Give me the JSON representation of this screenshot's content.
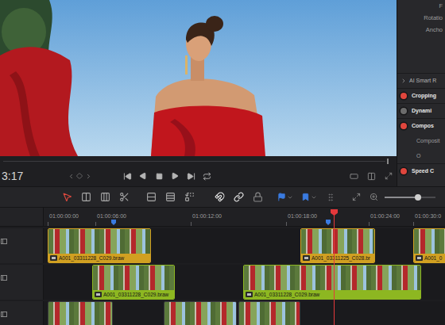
{
  "viewer": {
    "timecode": "3:17"
  },
  "inspector": {
    "params": [
      "F",
      "Rotatio",
      "Ancho"
    ],
    "sections": [
      {
        "label": "AI Smart R",
        "kind": "collapsed"
      },
      {
        "label": "Cropping",
        "kind": "toggle",
        "enabled": true
      },
      {
        "label": "Dynami",
        "kind": "toggle",
        "enabled": false
      },
      {
        "label": "Compos",
        "kind": "toggle",
        "enabled": true
      },
      {
        "label": "Composit",
        "kind": "param"
      },
      {
        "label": "O",
        "kind": "param"
      },
      {
        "label": "Speed C",
        "kind": "toggle",
        "enabled": true
      }
    ]
  },
  "toolbar": {
    "edit_tools": [
      {
        "selected": true
      },
      {
        "selected": false
      },
      {
        "selected": false
      },
      {
        "selected": false
      }
    ],
    "switches": [
      {
        "on": true
      },
      {
        "on": true
      },
      {
        "on": false
      }
    ],
    "zoom": {
      "level": 0.66
    }
  },
  "ruler": {
    "ticks": [
      "01:00:00:00",
      "01:00:06:00",
      "01:00:12:00",
      "01:00:18:00",
      "01:00:24:00",
      "01:00:30:0"
    ]
  },
  "tracks": [
    {
      "clips": [
        {
          "kind": "labeled",
          "name": "A001_03311228_C029.braw",
          "color": "#d1a021"
        },
        {
          "kind": "labeled",
          "name": "A001_03311225_C028.br",
          "color": "#d1a021"
        },
        {
          "kind": "labeled",
          "name": "A001_0",
          "color": "#d1a021"
        }
      ]
    },
    {
      "clips": [
        {
          "kind": "labeled",
          "name": "A001_03311228_C029.braw",
          "color": "#8db721"
        },
        {
          "kind": "labeled",
          "name": "A001_03311228_C029.braw",
          "color": "#8db721"
        }
      ]
    },
    {
      "clips": [
        {
          "kind": "thumbnails"
        },
        {
          "kind": "thumbnails"
        },
        {
          "kind": "thumbnails"
        }
      ]
    }
  ]
}
